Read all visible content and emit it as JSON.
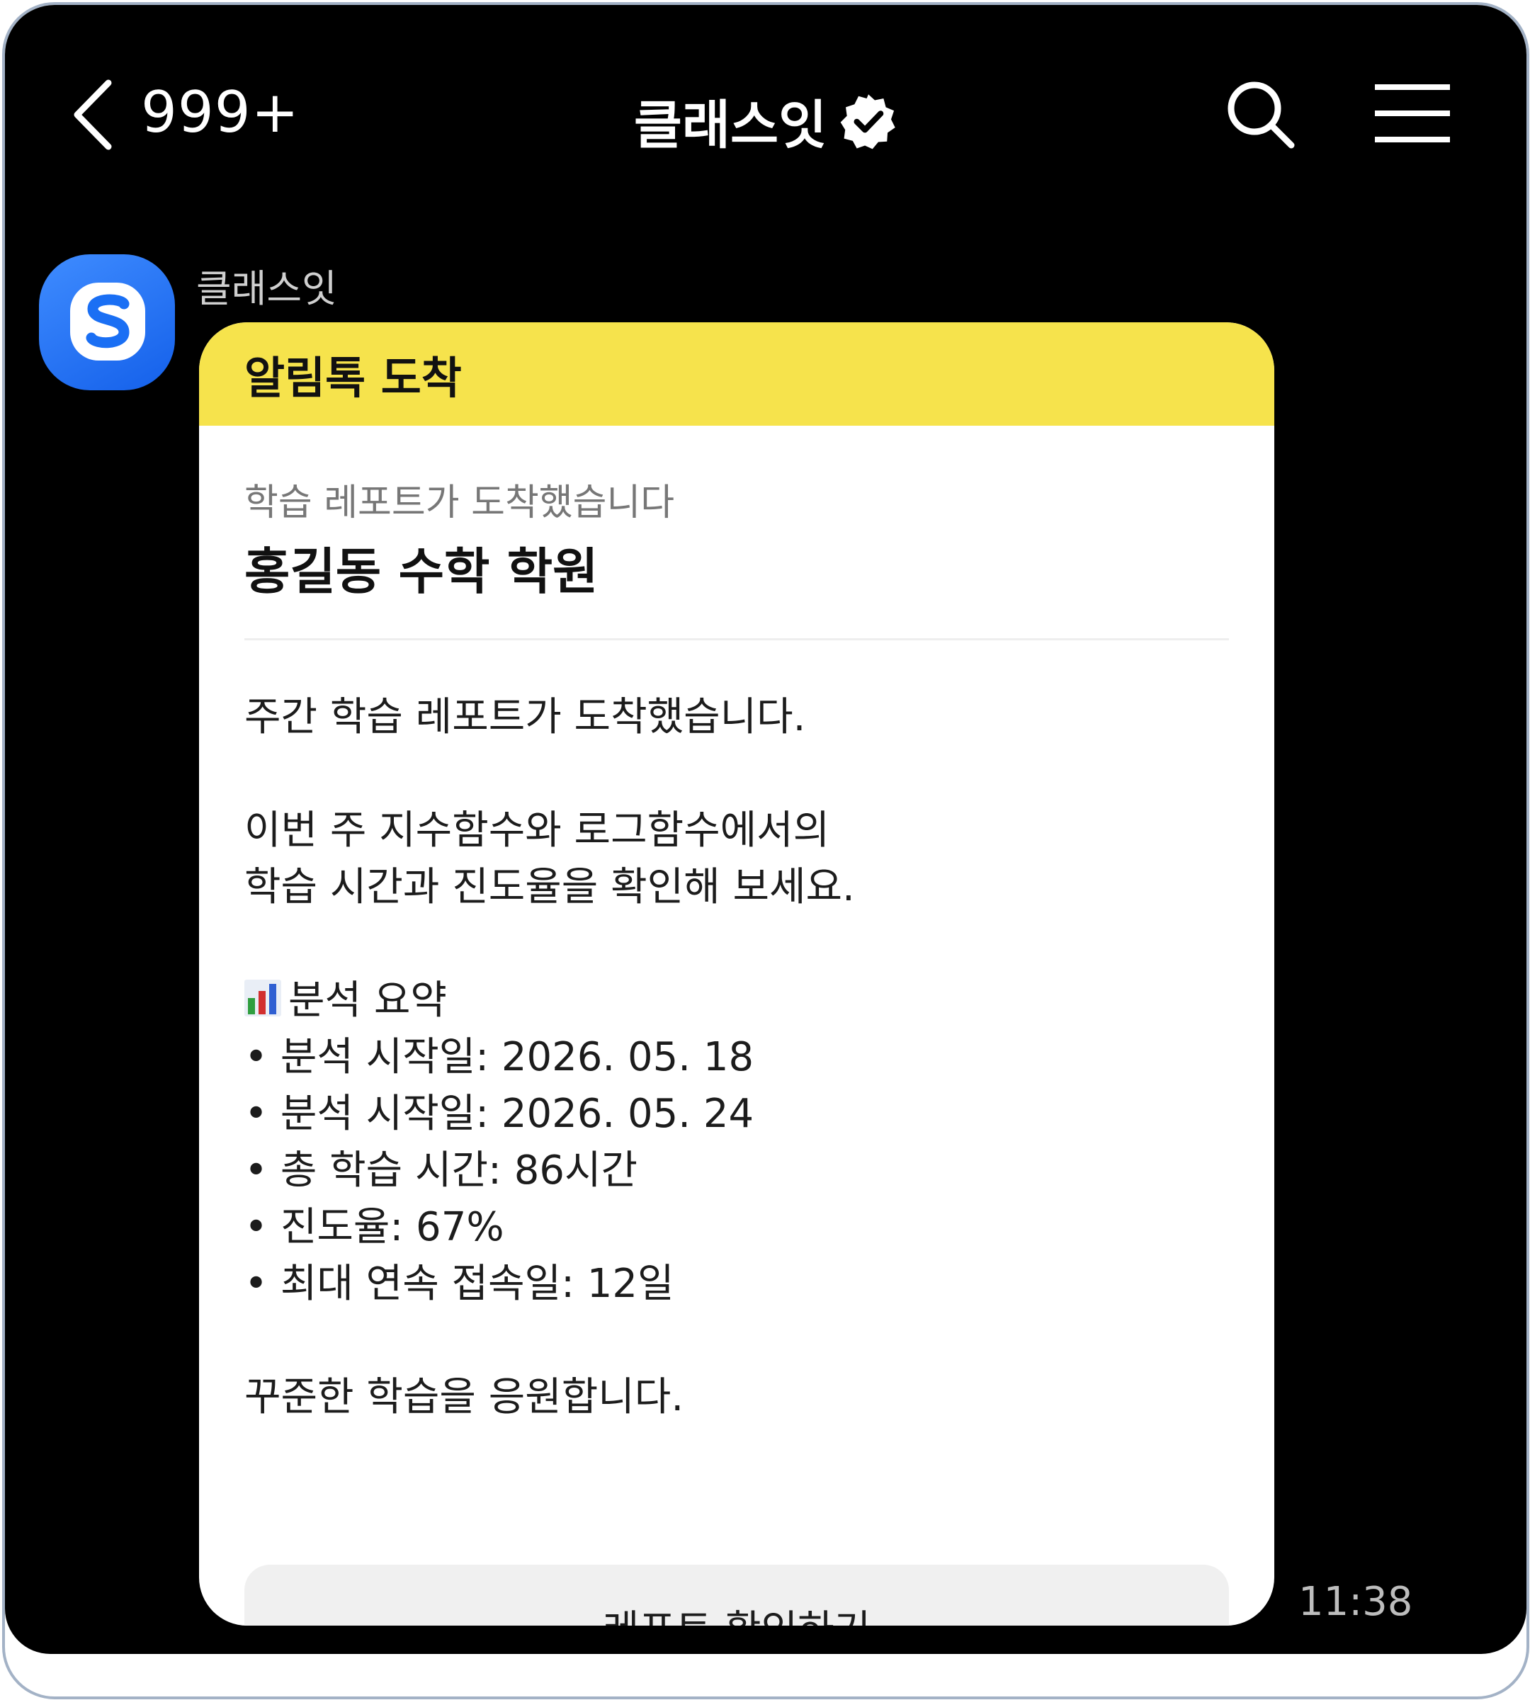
{
  "header": {
    "unread_count": "999+",
    "title": "클래스잇",
    "back_icon": "chevron-left-icon",
    "verified_icon": "verified-badge-icon",
    "search_icon": "search-icon",
    "menu_icon": "hamburger-menu-icon"
  },
  "message": {
    "sender_name": "클래스잇",
    "avatar_icon": "classit-logo-icon",
    "avatar_color": "#1a6ff4",
    "banner": "알림톡 도착",
    "banner_color": "#f6e34c",
    "subtitle": "학습 레포트가 도착했습니다",
    "academy_name": "홍길동 수학 학원",
    "body_line1": "주간 학습 레포트가 도착했습니다.",
    "body_line2": "이번 주 지수함수와 로그함수에서의",
    "body_line3": "학습 시간과 진도율을 확인해 보세요.",
    "summary_icon": "bar-chart-icon",
    "summary_heading": "분석 요약",
    "summary_items": [
      "• 분석 시작일: 2026. 05. 18",
      "• 분석 시작일: 2026. 05. 24",
      "• 총 학습 시간: 86시간",
      "• 진도율: 67%",
      "• 최대 연속 접속일: 12일"
    ],
    "closing": "꾸준한 학습을 응원합니다.",
    "button_label": "레포트 확인하기",
    "time": "11:38"
  }
}
